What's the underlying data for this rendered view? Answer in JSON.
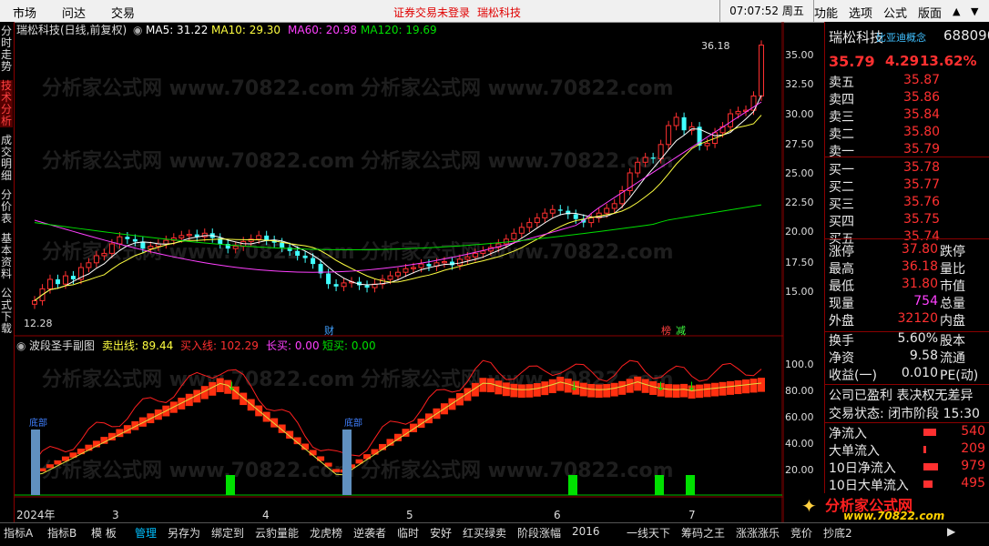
{
  "menu": {
    "items": [
      "市场",
      "问达",
      "交易"
    ],
    "notice": "证券交易未登录",
    "stock_name": "瑞松科技",
    "time": "07:07:52 周五",
    "right_items": [
      "功能",
      "选项",
      "公式",
      "版面"
    ]
  },
  "left_tabs": [
    "分时走势",
    "技术分析",
    "成交明细",
    "分价表",
    "基本资料",
    "公式下载"
  ],
  "main_chart": {
    "title": "瑞松科技(日线,前复权)",
    "ma": [
      {
        "label": "MA5: 31.22",
        "color": "#ffffff"
      },
      {
        "label": "MA10: 29.30",
        "color": "#ffff40"
      },
      {
        "label": "MA60: 20.98",
        "color": "#ff40ff"
      },
      {
        "label": "MA120: 19.69",
        "color": "#00e000"
      }
    ],
    "y_ticks": [
      "35.00",
      "32.50",
      "30.00",
      "27.50",
      "25.00",
      "22.50",
      "20.00",
      "17.50",
      "15.00"
    ],
    "high_label": "36.18",
    "low_label": "12.28",
    "markers": {
      "cai": "财",
      "bang": "榜",
      "jian": "减"
    },
    "watermark": "分析家公式网 www.70822.com"
  },
  "sub_chart": {
    "title": "波段圣手副图",
    "lines": [
      {
        "label": "卖出线: 89.44",
        "color": "#ffff40"
      },
      {
        "label": "买入线: 102.29",
        "color": "#ff3030"
      },
      {
        "label": "长买: 0.00",
        "color": "#ff40ff"
      },
      {
        "label": "短买: 0.00",
        "color": "#00e000"
      }
    ],
    "y_ticks": [
      "100.0",
      "80.00",
      "60.00",
      "40.00",
      "20.00"
    ],
    "tags": [
      "底部",
      "底部"
    ]
  },
  "x_axis": {
    "labels": [
      "2024年",
      "3",
      "4",
      "5",
      "6",
      "7"
    ]
  },
  "quote": {
    "name": "瑞松科技",
    "concept": "比亚迪概念",
    "code": "688090",
    "price": "35.79",
    "change": "4.29",
    "pct": "13.62%",
    "asks": [
      {
        "label": "卖五",
        "price": "35.87"
      },
      {
        "label": "卖四",
        "price": "35.86"
      },
      {
        "label": "卖三",
        "price": "35.84"
      },
      {
        "label": "卖二",
        "price": "35.80"
      },
      {
        "label": "卖一",
        "price": "35.79"
      }
    ],
    "bids": [
      {
        "label": "买一",
        "price": "35.78"
      },
      {
        "label": "买二",
        "price": "35.77"
      },
      {
        "label": "买三",
        "price": "35.76"
      },
      {
        "label": "买四",
        "price": "35.75"
      },
      {
        "label": "买五",
        "price": "35.74"
      }
    ],
    "stats": [
      {
        "l": "涨停",
        "v": "37.80",
        "r": "跌停"
      },
      {
        "l": "最高",
        "v": "36.18",
        "r": "量比"
      },
      {
        "l": "最低",
        "v": "31.80",
        "r": "市值"
      },
      {
        "l": "现量",
        "v": "754",
        "r": "总量"
      },
      {
        "l": "外盘",
        "v": "32120",
        "r": "内盘"
      }
    ],
    "stats2": [
      {
        "l": "换手",
        "v": "5.60%",
        "r": "股本"
      },
      {
        "l": "净资",
        "v": "9.58",
        "r": "流通"
      },
      {
        "l": "收益(一)",
        "v": "0.010",
        "r": "PE(动)"
      }
    ],
    "info1": "公司已盈利 表决权无差异",
    "info2": "交易状态: 闭市阶段 15:30",
    "flows": [
      {
        "l": "净流入",
        "v": "540"
      },
      {
        "l": "大单流入",
        "v": "209"
      },
      {
        "l": "10日净流入",
        "v": "979"
      },
      {
        "l": "10日大单流入",
        "v": "495"
      }
    ],
    "brand": "分析家公式网",
    "brand_url": "www.70822.com"
  },
  "bottom_tabs": [
    "指标A",
    "指标B",
    "模 板",
    "管理",
    "另存为",
    "绑定到",
    "云豹量能",
    "龙虎榜",
    "逆袭者",
    "临时",
    "安好",
    "红买绿卖",
    "阶段涨幅",
    "2016",
    "一线天下",
    "筹码之王",
    "涨涨涨乐",
    "竞价",
    "抄底2"
  ],
  "active_bottom_tab": "管理"
}
